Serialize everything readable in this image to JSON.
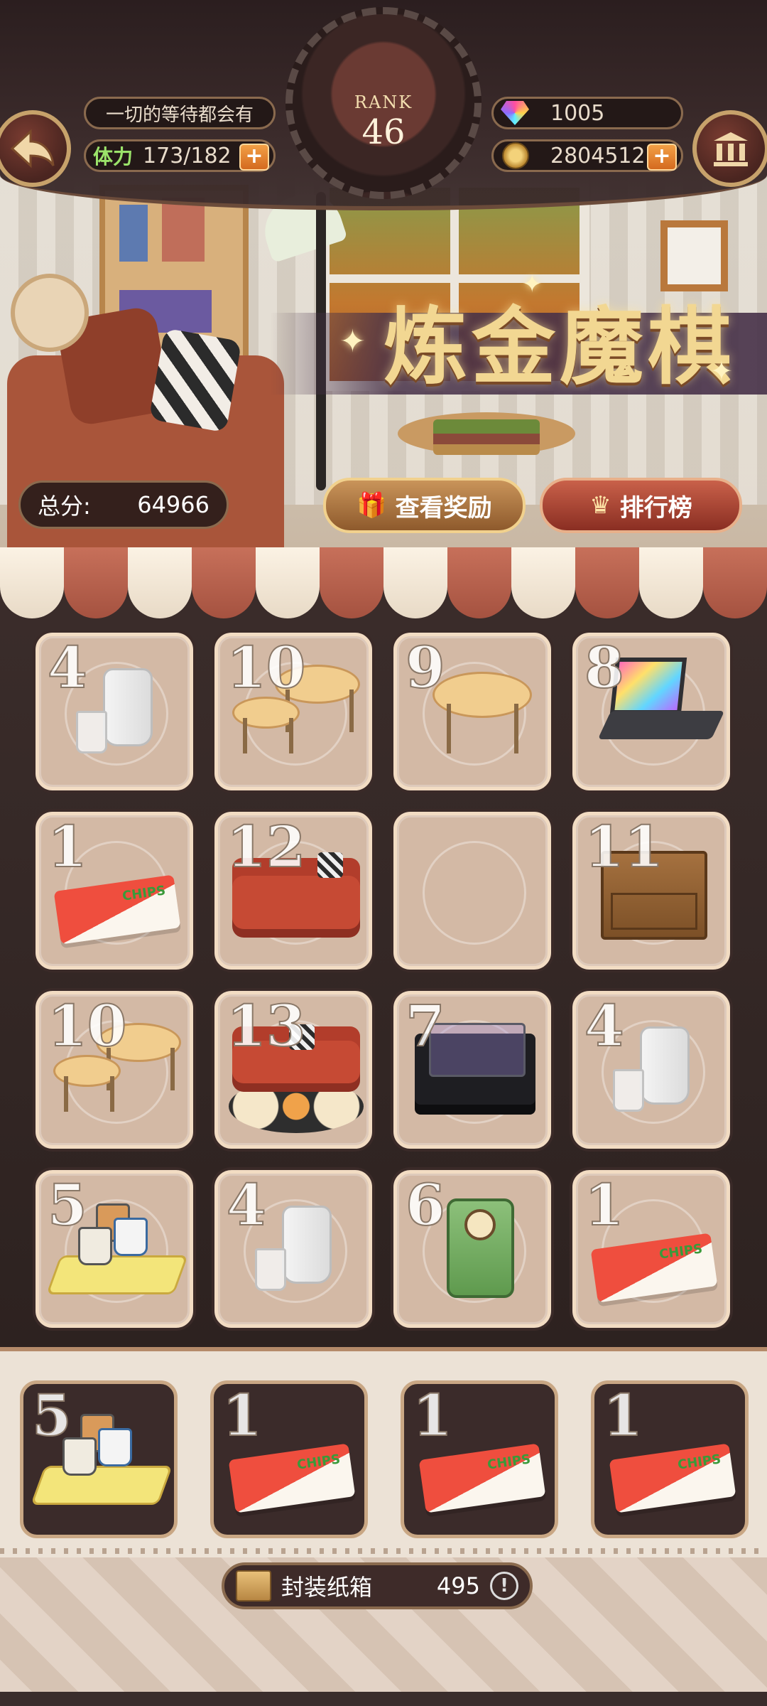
{
  "header": {
    "motto": "一切的等待都会有",
    "stamina_label": "体力",
    "stamina": "173/182",
    "gems": "1005",
    "gold": "2804512",
    "plus_label": "+",
    "rank_label": "RANK",
    "rank_value": "46",
    "back_icon": "back-arrow-icon",
    "bank_icon": "bank-icon"
  },
  "scene": {
    "title": "炼金魔棋",
    "score_label": "总分:",
    "score_value": "64966",
    "reward_button": "查看奖励",
    "ranking_button": "排行榜",
    "reward_icon": "gift-icon",
    "ranking_icon": "podium-icon"
  },
  "board": {
    "cells": [
      {
        "level": "4",
        "item": "water-pitcher"
      },
      {
        "level": "10",
        "item": "nesting-tables"
      },
      {
        "level": "9",
        "item": "side-table"
      },
      {
        "level": "8",
        "item": "laptop"
      },
      {
        "level": "1",
        "item": "chips-bag"
      },
      {
        "level": "12",
        "item": "red-sofa"
      },
      {
        "level": "",
        "item": "empty"
      },
      {
        "level": "11",
        "item": "wooden-cabinet"
      },
      {
        "level": "10",
        "item": "nesting-tables"
      },
      {
        "level": "13",
        "item": "sofa-with-rug"
      },
      {
        "level": "7",
        "item": "turntable"
      },
      {
        "level": "4",
        "item": "water-pitcher"
      },
      {
        "level": "5",
        "item": "mug-tray"
      },
      {
        "level": "4",
        "item": "water-pitcher"
      },
      {
        "level": "6",
        "item": "coffee-machine"
      },
      {
        "level": "1",
        "item": "chips-bag"
      }
    ]
  },
  "tray": {
    "slots": [
      {
        "level": "5",
        "item": "mug-tray"
      },
      {
        "level": "1",
        "item": "chips-bag"
      },
      {
        "level": "1",
        "item": "chips-bag"
      },
      {
        "level": "1",
        "item": "chips-bag"
      }
    ],
    "box_label": "封装纸箱",
    "box_count": "495",
    "info_icon": "info-icon"
  },
  "chips_text": "CHIPS",
  "colors": {
    "accent_gold": "#f2d792",
    "cell_bg": "#d3b9a5",
    "board_bg": "#3b2d2b"
  }
}
